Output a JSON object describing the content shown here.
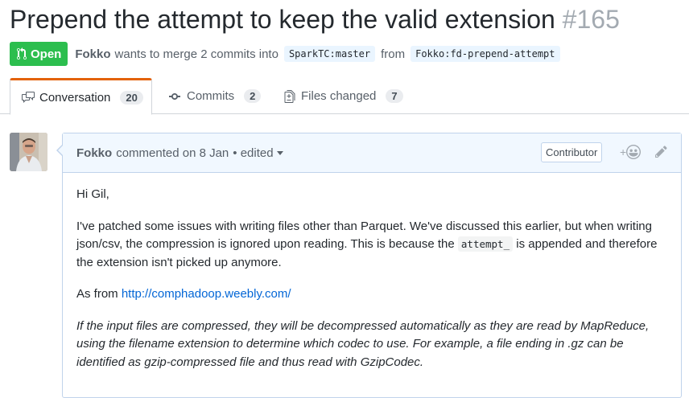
{
  "pr": {
    "title": "Prepend the attempt to keep the valid extension",
    "number": "#165",
    "state": "Open",
    "author": "Fokko",
    "merge_text": "wants to merge 2 commits into",
    "base_branch": "SparkTC:master",
    "from_text": "from",
    "head_branch": "Fokko:fd-prepend-attempt"
  },
  "tabs": [
    {
      "label": "Conversation",
      "count": "20",
      "icon": "comment-discussion-icon"
    },
    {
      "label": "Commits",
      "count": "2",
      "icon": "git-commit-icon"
    },
    {
      "label": "Files changed",
      "count": "7",
      "icon": "file-diff-icon"
    }
  ],
  "comment": {
    "author": "Fokko",
    "meta": "commented on 8 Jan",
    "edited": "• edited",
    "role": "Contributor",
    "reaction_plus": "+",
    "greeting": "Hi Gil,",
    "p1_before": "I've patched some issues with writing files other than Parquet. We've discussed this earlier, but when writing json/csv, the compression is ignored upon reading. This is because the ",
    "p1_code": "attempt_",
    "p1_after": " is appended and therefore the extension isn't picked up anymore.",
    "p2_before": "As from ",
    "p2_link": "http://comphadoop.weebly.com/",
    "quote": "If the input files are compressed, they will be decompressed automatically as they are read by MapReduce, using the filename extension to determine which codec to use. For example, a file ending in .gz can be identified as gzip-compressed file and thus read with GzipCodec."
  },
  "colors": {
    "open_green": "#2cbe4e",
    "tab_accent": "#e36209",
    "link_blue": "#0366d6",
    "comment_header_bg": "#f1f8ff"
  }
}
